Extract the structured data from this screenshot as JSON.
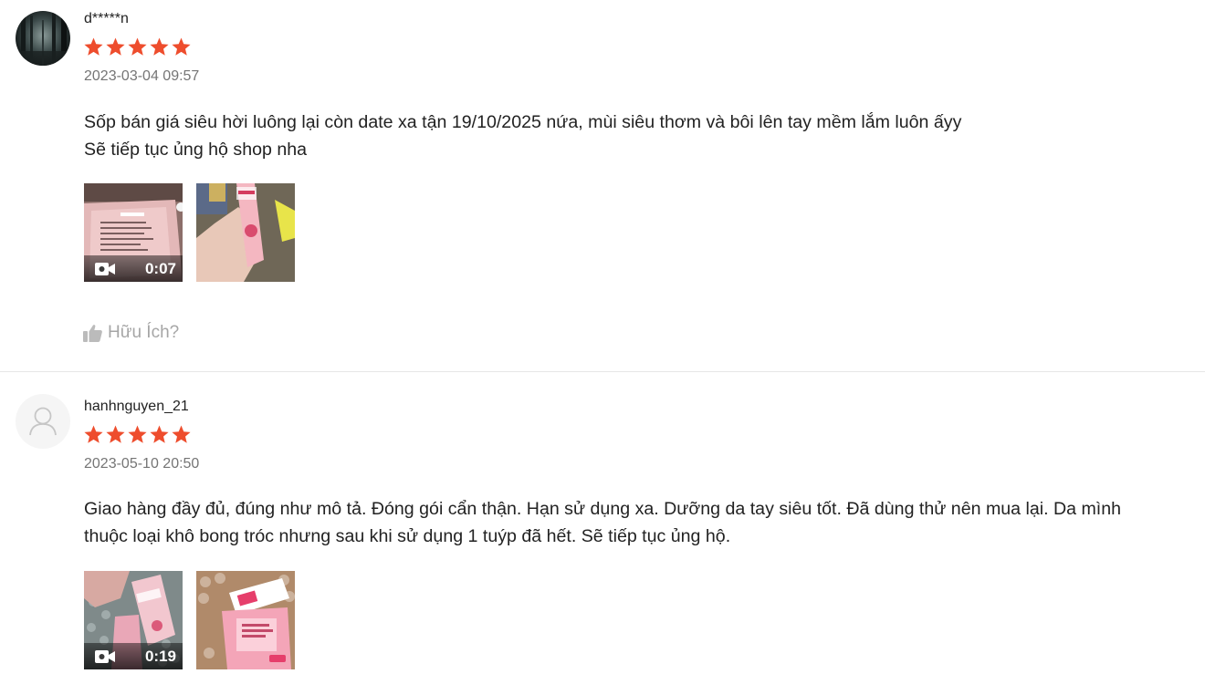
{
  "colors": {
    "star": "#ee4d2d",
    "divider": "#e6e6e6",
    "muted": "#757575",
    "helpful": "#a6a6a6"
  },
  "reviews": [
    {
      "username": "d*****n",
      "rating": 5,
      "rating_max": 5,
      "date": "2023-03-04 09:57",
      "content_lines": [
        "Sốp bán giá siêu hời luông lại còn date xa tận 19/10/2025 nứa, mùi siêu thơm và bôi lên tay mềm lắm luôn ấyy",
        "Sẽ tiếp tục ủng hộ shop nha"
      ],
      "media": [
        {
          "type": "video",
          "duration": "0:07",
          "icon": "video-camera-icon"
        },
        {
          "type": "image"
        }
      ],
      "helpful_label": "Hữu Ích?",
      "helpful_icon": "thumbs-up-icon",
      "avatar_icon": "forest-avatar-icon"
    },
    {
      "username": "hanhnguyen_21",
      "rating": 5,
      "rating_max": 5,
      "date": "2023-05-10 20:50",
      "content_lines": [
        "Giao hàng đầy đủ, đúng như mô tả. Đóng gói cẩn thận. Hạn sử dụng xa. Dưỡng da tay siêu tốt. Đã dùng thử nên mua lại. Da mình",
        "thuộc loại khô bong tróc nhưng sau khi sử dụng 1 tuýp đã hết. Sẽ tiếp tục ủng hộ."
      ],
      "media": [
        {
          "type": "video",
          "duration": "0:19",
          "icon": "video-camera-icon"
        },
        {
          "type": "image"
        }
      ],
      "avatar_icon": "default-user-icon"
    }
  ]
}
